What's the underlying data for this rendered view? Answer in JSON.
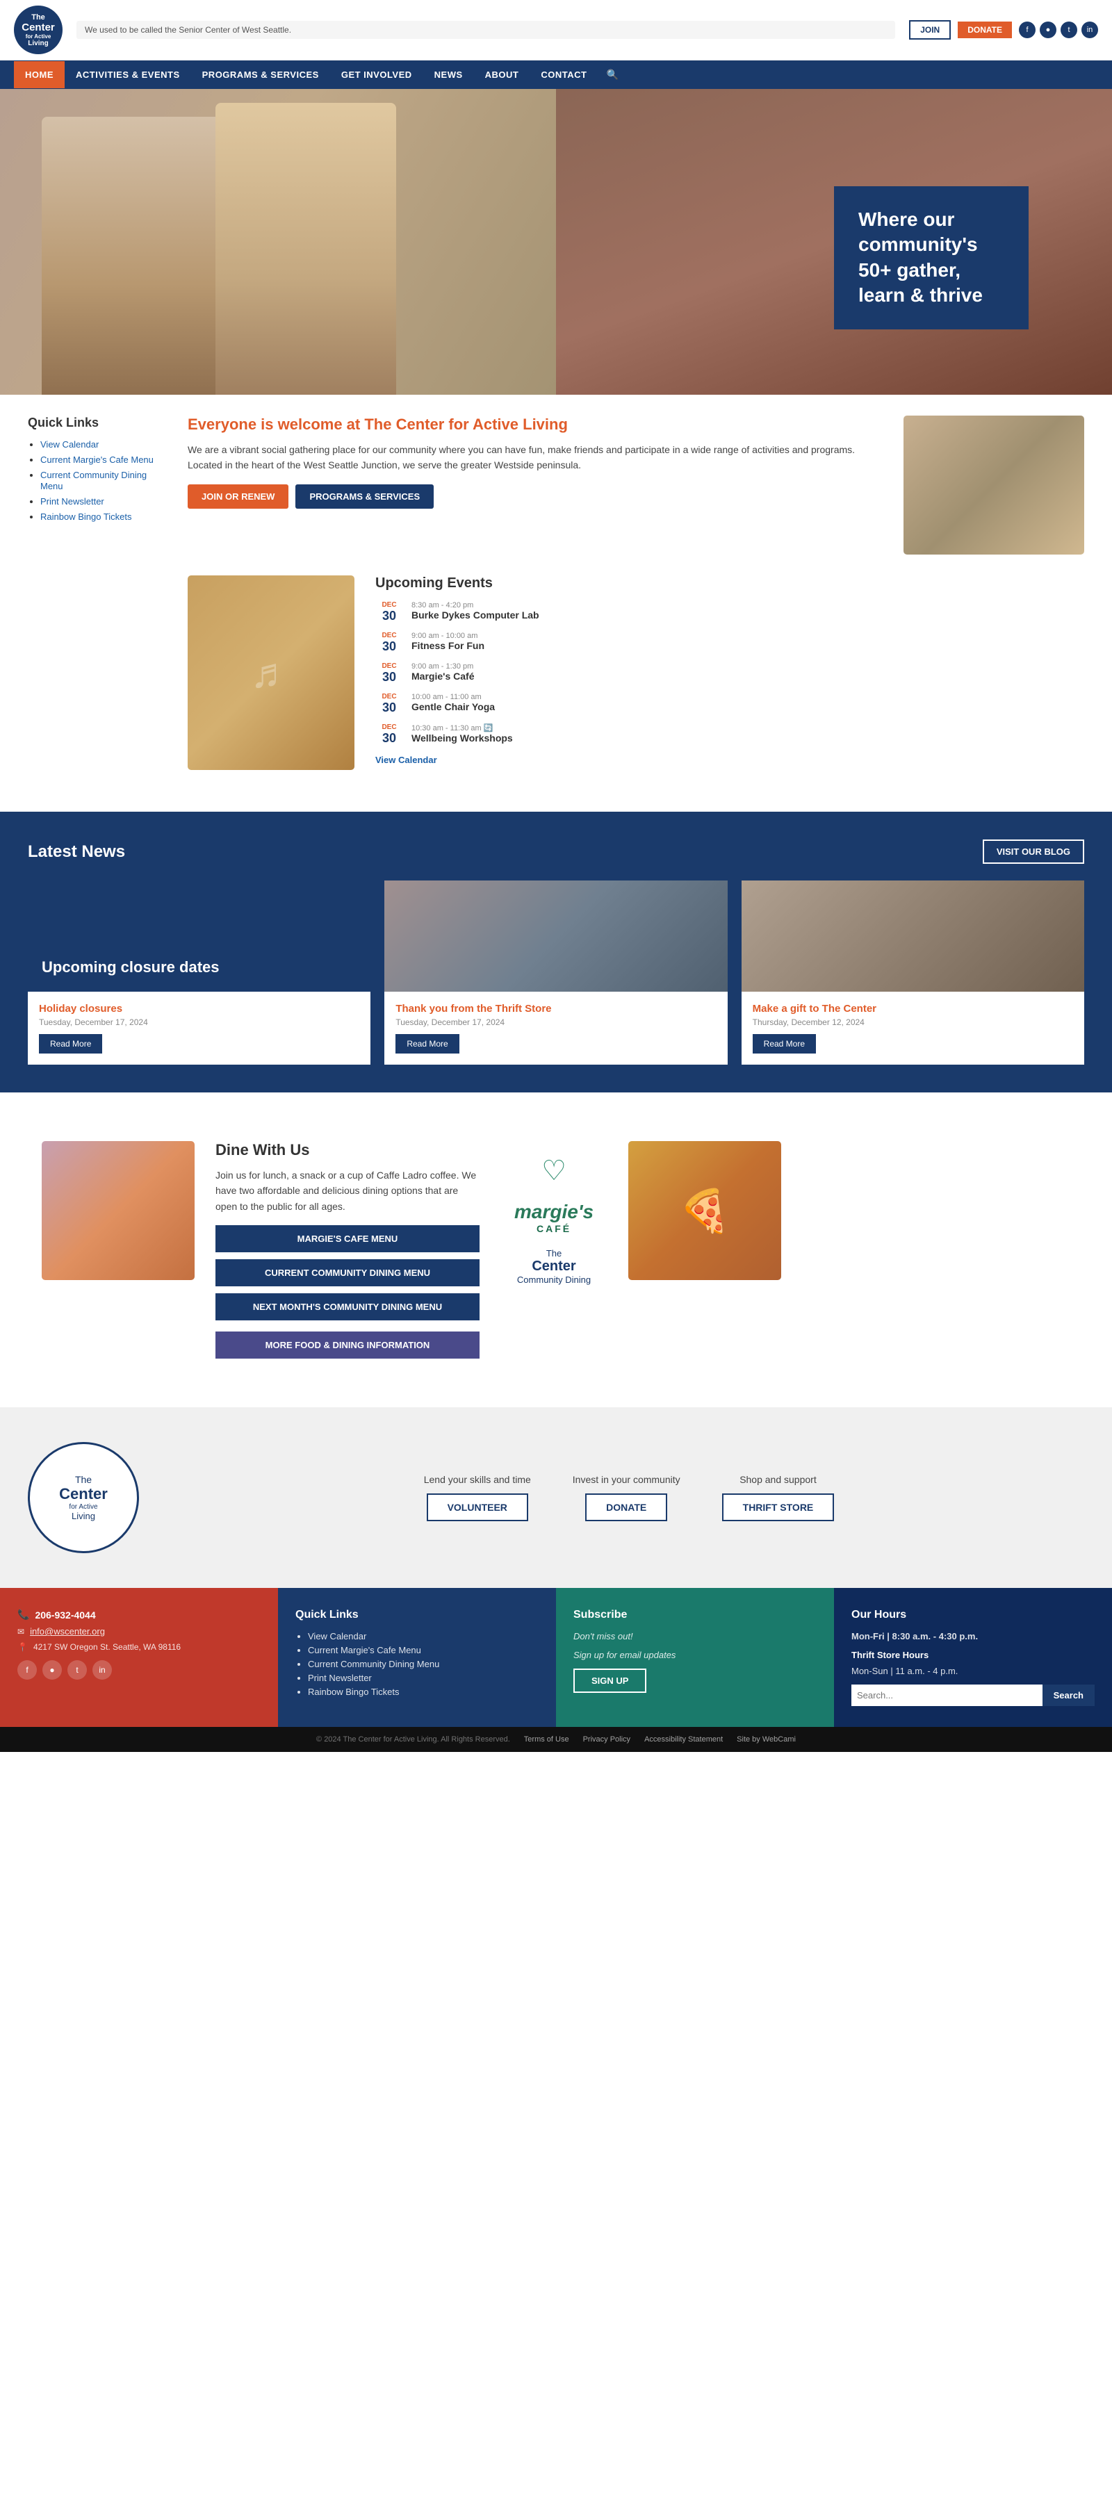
{
  "site": {
    "name": "The Center for Active Living",
    "tagline": "We used to be called the Senior Center of West Seattle."
  },
  "topbar": {
    "message": "We used to be called the Senior Center of West Seattle.",
    "join_label": "JOIN",
    "donate_label": "DONATE"
  },
  "nav": {
    "items": [
      {
        "label": "HOME",
        "active": true
      },
      {
        "label": "ACTIVITIES & EVENTS"
      },
      {
        "label": "PROGRAMS & SERVICES"
      },
      {
        "label": "GET INVOLVED"
      },
      {
        "label": "NEWS"
      },
      {
        "label": "ABOUT"
      },
      {
        "label": "CONTACT"
      }
    ]
  },
  "hero": {
    "tagline": "Where our community's 50+ gather, learn & thrive"
  },
  "quick_links": {
    "title": "Quick Links",
    "items": [
      {
        "label": "View Calendar"
      },
      {
        "label": "Current Margie's Cafe Menu"
      },
      {
        "label": "Current Community Dining Menu"
      },
      {
        "label": "Print Newsletter"
      },
      {
        "label": "Rainbow Bingo Tickets"
      }
    ]
  },
  "welcome": {
    "heading": "Everyone is welcome at The Center for Active Living",
    "body": "We are a vibrant social gathering place for our community where you can have fun, make friends and participate in a wide range of activities and programs. Located in the heart of the West Seattle Junction, we serve the greater Westside peninsula.",
    "btn_join": "JOIN OR RENEW",
    "btn_programs": "PROGRAMS & SERVICES"
  },
  "events": {
    "heading": "Upcoming Events",
    "items": [
      {
        "month": "DEC",
        "day": "30",
        "time": "8:30 am - 4:20 pm",
        "name": "Burke Dykes Computer Lab"
      },
      {
        "month": "DEC",
        "day": "30",
        "time": "9:00 am - 10:00 am",
        "name": "Fitness For Fun"
      },
      {
        "month": "DEC",
        "day": "30",
        "time": "9:00 am - 1:30 pm",
        "name": "Margie's Café"
      },
      {
        "month": "DEC",
        "day": "30",
        "time": "10:00 am - 11:00 am",
        "name": "Gentle Chair Yoga"
      },
      {
        "month": "DEC",
        "day": "30",
        "time": "10:30 am - 11:30 am",
        "name": "Wellbeing Workshops"
      }
    ],
    "view_calendar": "View Calendar"
  },
  "latest_news": {
    "heading": "Latest News",
    "visit_blog_label": "VISIT OUR BLOG",
    "cards": [
      {
        "image_type": "dark",
        "top_title": "Upcoming closure dates",
        "subtitle": "Holiday closures",
        "date": "Tuesday, December 17, 2024",
        "read_more": "Read More"
      },
      {
        "image_type": "photo1",
        "top_title": "",
        "subtitle": "Thank you from the Thrift Store",
        "date": "Tuesday, December 17, 2024",
        "read_more": "Read More"
      },
      {
        "image_type": "photo2",
        "top_title": "",
        "subtitle": "Make a gift to The Center",
        "date": "Thursday, December 12, 2024",
        "read_more": "Read More"
      }
    ]
  },
  "dine": {
    "heading": "Dine With Us",
    "body": "Join us for lunch, a snack or a cup of Caffe Ladro coffee. We have two affordable and delicious dining options that are open to the public for all ages.",
    "btn_margie": "MARGIE'S CAFE MENU",
    "btn_community": "CURRENT COMMUNITY DINING MENU",
    "btn_next": "NEXT MONTH'S COMMUNITY DINING MENU",
    "btn_more": "MORE FOOD & DINING INFORMATION",
    "margie_name": "margie's",
    "margie_cafe": "CAFÉ",
    "center_label": "The Center",
    "community_dining": "Community Dining"
  },
  "get_involved": {
    "items": [
      {
        "label": "Lend your skills and time",
        "btn": "VOLUNTEER"
      },
      {
        "label": "Invest in your community",
        "btn": "DONATE"
      },
      {
        "label": "Shop and support",
        "btn": "THRIFT STORE"
      }
    ]
  },
  "footer": {
    "phone": "206-932-4044",
    "email": "info@wscenter.org",
    "address": "4217 SW Oregon St. Seattle, WA 98116",
    "quick_links": {
      "title": "Quick Links",
      "items": [
        {
          "label": "View Calendar"
        },
        {
          "label": "Current Margie's Cafe Menu"
        },
        {
          "label": "Current Community Dining Menu"
        },
        {
          "label": "Print Newsletter"
        },
        {
          "label": "Rainbow Bingo Tickets"
        }
      ]
    },
    "subscribe": {
      "title": "Subscribe",
      "subtitle": "Don't miss out!",
      "body": "Sign up for email updates",
      "btn": "SIGN UP"
    },
    "hours": {
      "title": "Our Hours",
      "main": "Mon-Fri | 8:30 a.m. - 4:30 p.m.",
      "thrift_title": "Thrift Store Hours",
      "thrift": "Mon-Sun | 11 a.m. - 4 p.m.",
      "search_placeholder": "Search...",
      "search_btn": "Search"
    }
  },
  "footer_bottom": {
    "copyright": "© 2024 The Center for Active Living. All Rights Reserved.",
    "links": [
      "Terms of Use",
      "Privacy Policy",
      "Accessibility Statement",
      "Site by WebCami"
    ]
  }
}
